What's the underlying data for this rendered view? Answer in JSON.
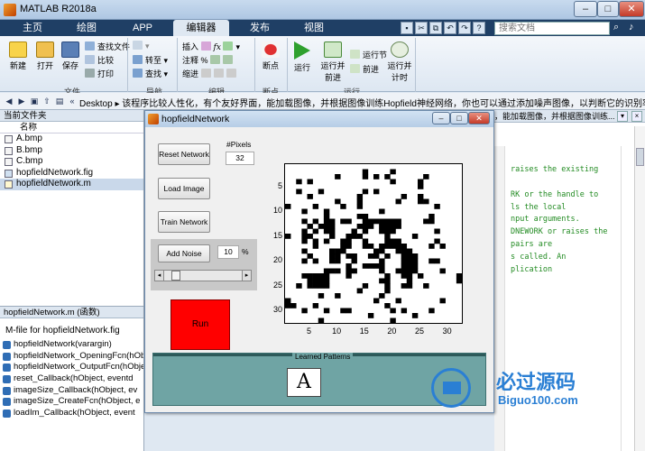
{
  "window": {
    "title": "MATLAB R2018a"
  },
  "tabs": [
    {
      "label": "主页",
      "active": false
    },
    {
      "label": "绘图",
      "active": false
    },
    {
      "label": "APP",
      "active": false
    },
    {
      "label": "编辑器",
      "active": true
    },
    {
      "label": "发布",
      "active": false
    },
    {
      "label": "视图",
      "active": false
    }
  ],
  "search": {
    "placeholder": "搜索文档"
  },
  "ribbon": {
    "file": {
      "new": "新建",
      "open": "打开",
      "save": "保存",
      "find_files": "查找文件",
      "compare": "比较",
      "print": "打印",
      "group": "文件"
    },
    "nav": {
      "goto": "转至",
      "find": "查找",
      "group": "导航"
    },
    "edit": {
      "insert": "插入",
      "comment": "注释",
      "indent": "缩进",
      "group": "编辑"
    },
    "breakpoints": {
      "label": "断点",
      "group": "断点"
    },
    "run": {
      "run": "运行",
      "run_advance": "运行并前进",
      "run_section": "运行节",
      "advance": "前进",
      "run_time": "运行并计时",
      "group": "运行"
    }
  },
  "address": {
    "path": "Desktop ▸ 该程序比较人性化，有个友好界面，能加载图像，并根据图像训练Hopfield神经网络，你也可以通过添加噪声图像，以判断它的识别率"
  },
  "current_folder": {
    "header": "当前文件夹",
    "col_name": "名称",
    "files": [
      {
        "name": "A.bmp",
        "selected": false
      },
      {
        "name": "B.bmp",
        "selected": false
      },
      {
        "name": "C.bmp",
        "selected": false
      },
      {
        "name": "hopfieldNetwork.fig",
        "selected": false
      },
      {
        "name": "hopfieldNetwork.m",
        "selected": true
      }
    ]
  },
  "details": {
    "header": "hopfieldNetwork.m (函数)",
    "desc": "M-file for hopfieldNetwork.fig",
    "functions": [
      "hopfieldNetwork(varargin)",
      "hopfieldNetwork_OpeningFcn(hObject",
      "hopfieldNetwork_OutputFcn(hObject",
      "reset_Callback(hObject, eventd",
      "imageSize_Callback(hObject, ev",
      "imageSize_CreateFcn(hObject, e",
      "loadIm_Callback(hObject, event"
    ]
  },
  "editor": {
    "tab_text": "，能加载图像，并根据图像训练...",
    "lines": [
      "raises the existing",
      "",
      "RK or the handle to",
      "",
      "ls the local",
      "nput arguments.",
      "",
      "DNEWORK or raises the",
      "pairs are",
      "s called.  An",
      "plication"
    ]
  },
  "figure": {
    "title": "hopfieldNetwork",
    "buttons": {
      "reset": "Reset Network",
      "load": "Load Image",
      "train": "Train Network",
      "add_noise": "Add Noise",
      "run": "Run"
    },
    "pixels_label": "#Pixels",
    "pixels_value": "32",
    "noise_value": "10",
    "noise_unit": "%",
    "noise_slider": 0.1,
    "learned_label": "Learned Patterns",
    "learned_letter": "A",
    "axes": {
      "x_ticks": [
        "5",
        "10",
        "15",
        "20",
        "25",
        "30"
      ],
      "y_ticks": [
        "5",
        "10",
        "15",
        "20",
        "25",
        "30"
      ]
    },
    "grid_size": 32,
    "grid_rows": [
      "................................",
      "..............#....#............",
      ".........#....#.#.#......#......",
      "..#.#..............#....#.......",
      "........................#.......",
      "..#...#.......#.#...............",
      "....#........#.......#..#.......",
      ".........#...#......#...##......",
      "#....#....#..#.............#....",
      "...#...#.........#..............",
      ".......#.....##...........#.....",
      "...#.#.##.##..#######....##.....",
      "....#.###....###.####...........",
      "...#.#.##...#.#..###.......#....",
      "#..##...#..###....#....#........",
      "...#.#.#..##..#...###......#....",
      ".....#....##..##.#####....#.#...",
      "...#....###.....##..###.........",
      "....#...##.##..##.#..###........",
      "...#.#..##..#....#...###..##....",
      "...........#..####...###........",
      ".......###.##....#..####....#...",
      "...#####...#......#..##.#......#",
      "....####.........##...#........#",
      "..#.####......#...#..##..#......",
      ".............#....#.............",
      "......#..#.......#..............",
      "#...............#...#.......#...",
      "##...#............#.............",
      "...#...#..##.......#.#....#.....",
      "...............#.......#........",
      "......#............#............"
    ]
  },
  "watermark": {
    "title": "必过源码",
    "url": "Biguo100.com"
  }
}
